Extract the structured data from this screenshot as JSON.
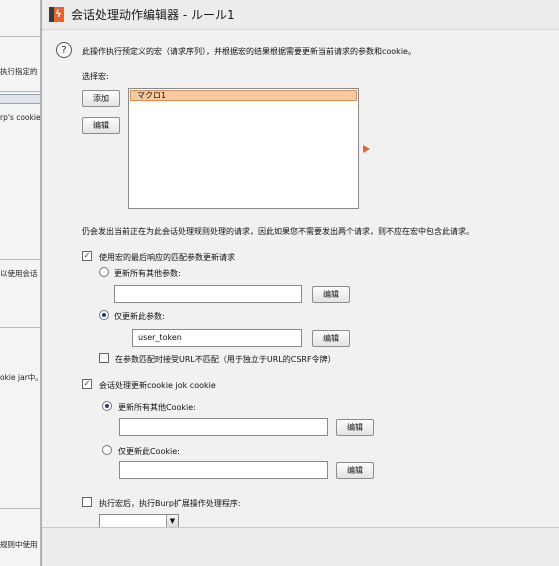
{
  "background_window": {
    "texts": [
      "执行指定的",
      "rp's cookie",
      "以使用会话",
      "okie jar中。",
      "规则中使用"
    ]
  },
  "window": {
    "title": "会话处理动作编辑器 - ルール1",
    "icon": "burp-app-icon"
  },
  "description": "此操作执行预定义的宏（请求序列），并根据宏的结果根据需要更新当前请求的参数和cookie。",
  "macro_section": {
    "label": "选择宏:",
    "add_button": "添加",
    "edit_button": "编辑",
    "items": [
      "マクロ1"
    ]
  },
  "notice": "仍会发出当前正在为此会话处理规则处理的请求，因此如果您不需要发出两个请求，则不应在宏中包含此请求。",
  "update_params": {
    "checkbox_label": "使用宏的最后响应的匹配参数更新请求",
    "checked": true,
    "radio_all_label": "更新所有其他参数:",
    "radio_all_value": "",
    "radio_only_label": "仅更新此参数:",
    "radio_only_value": "user_token",
    "edit_button_1": "编辑",
    "edit_button_2": "编辑",
    "url_mismatch_label": "在参数匹配时接受URL不匹配（用于独立于URL的CSRF令牌）",
    "url_mismatch_checked": false
  },
  "update_cookies": {
    "checkbox_label": "会话处理更新cookie jok cookie",
    "checked": true,
    "radio_all_label": "更新所有其他Cookie:",
    "radio_all_value": "",
    "radio_only_label": "仅更新此Cookie:",
    "radio_only_value": "",
    "edit_button_1": "编辑",
    "edit_button_2": "编辑"
  },
  "extension": {
    "checkbox_label": "执行宏后，执行Burp扩展操作处理程序:",
    "checked": false,
    "selected": ""
  },
  "colors": {
    "accent": "#e8642b",
    "selection": "#f8c99c"
  }
}
